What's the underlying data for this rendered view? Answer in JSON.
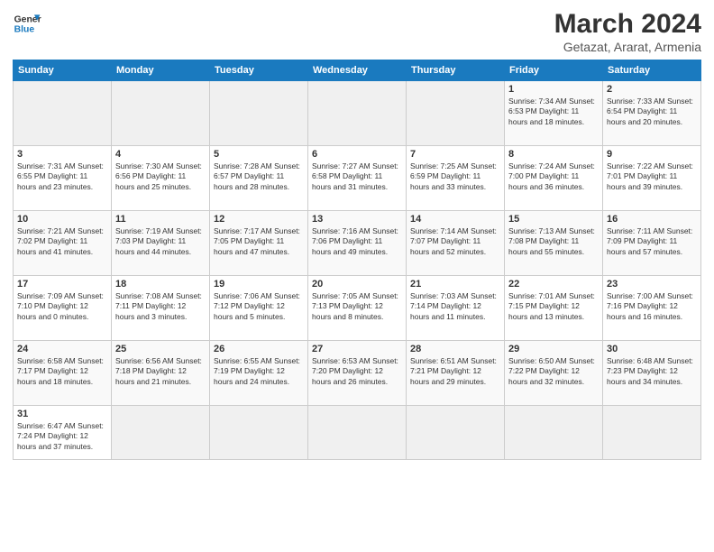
{
  "header": {
    "logo_general": "General",
    "logo_blue": "Blue",
    "title": "March 2024",
    "subtitle": "Getazat, Ararat, Armenia"
  },
  "weekdays": [
    "Sunday",
    "Monday",
    "Tuesday",
    "Wednesday",
    "Thursday",
    "Friday",
    "Saturday"
  ],
  "rows": [
    [
      {
        "day": "",
        "info": ""
      },
      {
        "day": "",
        "info": ""
      },
      {
        "day": "",
        "info": ""
      },
      {
        "day": "",
        "info": ""
      },
      {
        "day": "",
        "info": ""
      },
      {
        "day": "1",
        "info": "Sunrise: 7:34 AM\nSunset: 6:53 PM\nDaylight: 11 hours\nand 18 minutes."
      },
      {
        "day": "2",
        "info": "Sunrise: 7:33 AM\nSunset: 6:54 PM\nDaylight: 11 hours\nand 20 minutes."
      }
    ],
    [
      {
        "day": "3",
        "info": "Sunrise: 7:31 AM\nSunset: 6:55 PM\nDaylight: 11 hours\nand 23 minutes."
      },
      {
        "day": "4",
        "info": "Sunrise: 7:30 AM\nSunset: 6:56 PM\nDaylight: 11 hours\nand 25 minutes."
      },
      {
        "day": "5",
        "info": "Sunrise: 7:28 AM\nSunset: 6:57 PM\nDaylight: 11 hours\nand 28 minutes."
      },
      {
        "day": "6",
        "info": "Sunrise: 7:27 AM\nSunset: 6:58 PM\nDaylight: 11 hours\nand 31 minutes."
      },
      {
        "day": "7",
        "info": "Sunrise: 7:25 AM\nSunset: 6:59 PM\nDaylight: 11 hours\nand 33 minutes."
      },
      {
        "day": "8",
        "info": "Sunrise: 7:24 AM\nSunset: 7:00 PM\nDaylight: 11 hours\nand 36 minutes."
      },
      {
        "day": "9",
        "info": "Sunrise: 7:22 AM\nSunset: 7:01 PM\nDaylight: 11 hours\nand 39 minutes."
      }
    ],
    [
      {
        "day": "10",
        "info": "Sunrise: 7:21 AM\nSunset: 7:02 PM\nDaylight: 11 hours\nand 41 minutes."
      },
      {
        "day": "11",
        "info": "Sunrise: 7:19 AM\nSunset: 7:03 PM\nDaylight: 11 hours\nand 44 minutes."
      },
      {
        "day": "12",
        "info": "Sunrise: 7:17 AM\nSunset: 7:05 PM\nDaylight: 11 hours\nand 47 minutes."
      },
      {
        "day": "13",
        "info": "Sunrise: 7:16 AM\nSunset: 7:06 PM\nDaylight: 11 hours\nand 49 minutes."
      },
      {
        "day": "14",
        "info": "Sunrise: 7:14 AM\nSunset: 7:07 PM\nDaylight: 11 hours\nand 52 minutes."
      },
      {
        "day": "15",
        "info": "Sunrise: 7:13 AM\nSunset: 7:08 PM\nDaylight: 11 hours\nand 55 minutes."
      },
      {
        "day": "16",
        "info": "Sunrise: 7:11 AM\nSunset: 7:09 PM\nDaylight: 11 hours\nand 57 minutes."
      }
    ],
    [
      {
        "day": "17",
        "info": "Sunrise: 7:09 AM\nSunset: 7:10 PM\nDaylight: 12 hours\nand 0 minutes."
      },
      {
        "day": "18",
        "info": "Sunrise: 7:08 AM\nSunset: 7:11 PM\nDaylight: 12 hours\nand 3 minutes."
      },
      {
        "day": "19",
        "info": "Sunrise: 7:06 AM\nSunset: 7:12 PM\nDaylight: 12 hours\nand 5 minutes."
      },
      {
        "day": "20",
        "info": "Sunrise: 7:05 AM\nSunset: 7:13 PM\nDaylight: 12 hours\nand 8 minutes."
      },
      {
        "day": "21",
        "info": "Sunrise: 7:03 AM\nSunset: 7:14 PM\nDaylight: 12 hours\nand 11 minutes."
      },
      {
        "day": "22",
        "info": "Sunrise: 7:01 AM\nSunset: 7:15 PM\nDaylight: 12 hours\nand 13 minutes."
      },
      {
        "day": "23",
        "info": "Sunrise: 7:00 AM\nSunset: 7:16 PM\nDaylight: 12 hours\nand 16 minutes."
      }
    ],
    [
      {
        "day": "24",
        "info": "Sunrise: 6:58 AM\nSunset: 7:17 PM\nDaylight: 12 hours\nand 18 minutes."
      },
      {
        "day": "25",
        "info": "Sunrise: 6:56 AM\nSunset: 7:18 PM\nDaylight: 12 hours\nand 21 minutes."
      },
      {
        "day": "26",
        "info": "Sunrise: 6:55 AM\nSunset: 7:19 PM\nDaylight: 12 hours\nand 24 minutes."
      },
      {
        "day": "27",
        "info": "Sunrise: 6:53 AM\nSunset: 7:20 PM\nDaylight: 12 hours\nand 26 minutes."
      },
      {
        "day": "28",
        "info": "Sunrise: 6:51 AM\nSunset: 7:21 PM\nDaylight: 12 hours\nand 29 minutes."
      },
      {
        "day": "29",
        "info": "Sunrise: 6:50 AM\nSunset: 7:22 PM\nDaylight: 12 hours\nand 32 minutes."
      },
      {
        "day": "30",
        "info": "Sunrise: 6:48 AM\nSunset: 7:23 PM\nDaylight: 12 hours\nand 34 minutes."
      }
    ],
    [
      {
        "day": "31",
        "info": "Sunrise: 6:47 AM\nSunset: 7:24 PM\nDaylight: 12 hours\nand 37 minutes."
      },
      {
        "day": "",
        "info": ""
      },
      {
        "day": "",
        "info": ""
      },
      {
        "day": "",
        "info": ""
      },
      {
        "day": "",
        "info": ""
      },
      {
        "day": "",
        "info": ""
      },
      {
        "day": "",
        "info": ""
      }
    ]
  ]
}
